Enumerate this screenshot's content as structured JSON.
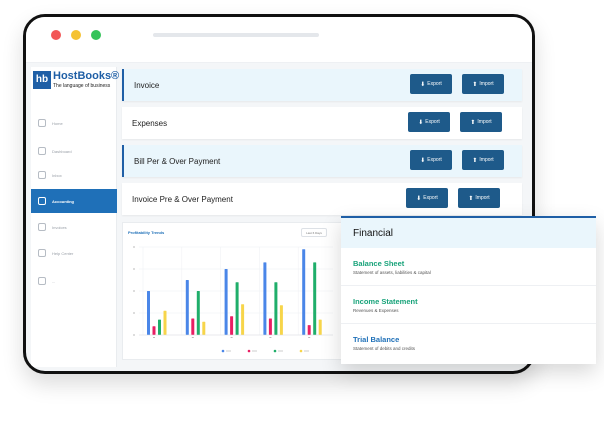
{
  "window": {
    "dots": [
      "#f25757",
      "#f5c232",
      "#35c35a"
    ]
  },
  "brand": {
    "mark": "hb",
    "name": "HostBooks®",
    "tagline": "The language of business"
  },
  "sidebar": {
    "items": [
      {
        "label": "Home",
        "icon": "home-icon",
        "active": false
      },
      {
        "label": "Dashboard",
        "icon": "dashboard-icon",
        "active": false
      },
      {
        "label": "Inbox",
        "icon": "inbox-icon",
        "active": false
      },
      {
        "label": "Accounting",
        "icon": "accounting-icon",
        "active": true
      },
      {
        "label": "Invoices",
        "icon": "invoice-icon",
        "active": false
      },
      {
        "label": "Help Center",
        "icon": "help-icon",
        "active": false
      },
      {
        "label": "...",
        "icon": "settings-icon",
        "active": false
      }
    ]
  },
  "rows": [
    {
      "label": "Invoice",
      "export": "Export",
      "import": "Import"
    },
    {
      "label": "Expenses",
      "export": "Export",
      "import": "Import"
    },
    {
      "label": "Bill Per & Over Payment",
      "export": "Export",
      "import": "Import"
    },
    {
      "label": "Invoice Pre & Over Payment",
      "export": "Export",
      "import": "Import"
    }
  ],
  "chart": {
    "title": "Profitability Trends",
    "dropdown": "Last 6 Days",
    "legend": [
      "",
      "",
      "",
      ""
    ]
  },
  "chart_data": {
    "type": "bar",
    "categories": [
      "1",
      "2",
      "3",
      "4",
      "5"
    ],
    "series": [
      {
        "color": "#4a86e8",
        "values": [
          40,
          50,
          60,
          66,
          78
        ]
      },
      {
        "color": "#e91e63",
        "values": [
          8,
          15,
          17,
          15,
          9
        ]
      },
      {
        "color": "#1fae6a",
        "values": [
          14,
          40,
          48,
          48,
          66
        ]
      },
      {
        "color": "#f7d54a",
        "values": [
          22,
          12,
          28,
          27,
          14
        ]
      }
    ],
    "ylim": [
      0,
      80
    ]
  },
  "financial": {
    "title": "Financial",
    "items": [
      {
        "title": "Balance Sheet",
        "subtitle": "Statement of assets, liabilities & capital"
      },
      {
        "title": "Income Statement",
        "subtitle": "Revenues & Expenses"
      },
      {
        "title": "Trial Balance",
        "subtitle": "Statement of debits and credits"
      }
    ]
  }
}
